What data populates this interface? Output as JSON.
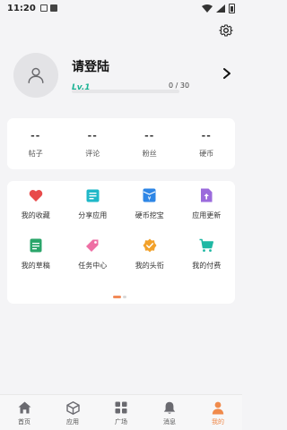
{
  "status_bar": {
    "time": "11:20"
  },
  "profile": {
    "login_title": "请登陆",
    "level": "Lv.1",
    "exp": "0 / 30",
    "progress_fraction": 0
  },
  "stats": [
    {
      "value": "--",
      "label": "帖子"
    },
    {
      "value": "--",
      "label": "评论"
    },
    {
      "value": "--",
      "label": "粉丝"
    },
    {
      "value": "--",
      "label": "硬币"
    }
  ],
  "grid": [
    {
      "label": "我的收藏",
      "icon": "heart-icon",
      "color": "#e84a4a"
    },
    {
      "label": "分享应用",
      "icon": "share-app-icon",
      "color": "#1fb8c8"
    },
    {
      "label": "硬币挖宝",
      "icon": "coin-treasure-icon",
      "color": "#2e86e6"
    },
    {
      "label": "应用更新",
      "icon": "app-update-icon",
      "color": "#9b6bdc"
    },
    {
      "label": "我的草稿",
      "icon": "draft-icon",
      "color": "#2aa56a"
    },
    {
      "label": "任务中心",
      "icon": "task-tag-icon",
      "color": "#ee6fa4"
    },
    {
      "label": "我的头衔",
      "icon": "title-badge-icon",
      "color": "#f2a12a"
    },
    {
      "label": "我的付费",
      "icon": "cart-icon",
      "color": "#1fb8a4"
    }
  ],
  "tabs": [
    {
      "label": "首页",
      "icon": "home-icon"
    },
    {
      "label": "应用",
      "icon": "apps-cube-icon"
    },
    {
      "label": "广场",
      "icon": "square-grid-icon"
    },
    {
      "label": "消息",
      "icon": "bell-icon"
    },
    {
      "label": "我的",
      "icon": "person-icon",
      "active": true
    }
  ],
  "colors": {
    "accent": "#1ab394",
    "active_tab": "#f08a4b",
    "background": "#f4f4f6"
  }
}
